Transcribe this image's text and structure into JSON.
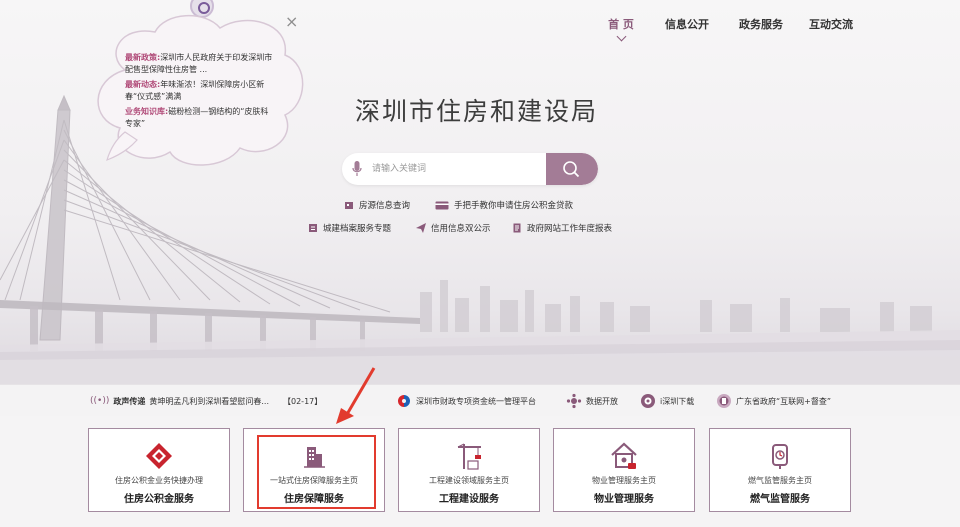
{
  "nav": {
    "items": [
      "首 页",
      "信息公开",
      "政务服务",
      "互动交流"
    ],
    "active_index": 0
  },
  "cloud": {
    "rows": [
      {
        "label": "最新政策:",
        "text": "深圳市人民政府关于印发深圳市配售型保障性住房管 ..."
      },
      {
        "label": "最新动态:",
        "text": "年味渐浓！深圳保障房小区新春“仪式感”满满"
      },
      {
        "label": "业务知识库:",
        "text": "磁粉检测—钢结构的“皮肤科专家”"
      }
    ],
    "close_label": "×"
  },
  "site_title": "深圳市住房和建设局",
  "search": {
    "placeholder": "请输入关键词",
    "button_icon": "search-icon"
  },
  "quick_links": [
    {
      "label": "房源信息查询",
      "icon": "house-info-icon"
    },
    {
      "label": "手把手教你申请住房公积金贷款",
      "icon": "card-icon"
    },
    {
      "label": "城建档案服务专题",
      "icon": "archive-icon"
    },
    {
      "label": "信用信息双公示",
      "icon": "send-icon"
    },
    {
      "label": "政府网站工作年度报表",
      "icon": "report-icon"
    }
  ],
  "infobar": {
    "notice_label": "政声传递",
    "notice_text": "黄坤明孟凡利到深圳看望慰问春...",
    "notice_date": "【02-17】",
    "links": [
      {
        "label": "深圳市财政专项资金统一管理平台",
        "icon": "finance-platform-icon"
      },
      {
        "label": "数据开放",
        "icon": "data-open-icon"
      },
      {
        "label": "i深圳下载",
        "icon": "i-shenzhen-icon"
      },
      {
        "label": "广东省政府“互联网+督查”",
        "icon": "supervision-icon"
      }
    ]
  },
  "cards": [
    {
      "sub": "住房公积金业务快捷办理",
      "main": "住房公积金服务",
      "icon": "housing-fund-icon"
    },
    {
      "sub": "一站式住房保障服务主页",
      "main": "住房保障服务",
      "icon": "building-icon"
    },
    {
      "sub": "工程建设领域服务主页",
      "main": "工程建设服务",
      "icon": "crane-icon"
    },
    {
      "sub": "物业管理服务主页",
      "main": "物业管理服务",
      "icon": "property-icon"
    },
    {
      "sub": "燃气监管服务主页",
      "main": "燃气监管服务",
      "icon": "gas-icon"
    }
  ],
  "colors": {
    "accent": "#a37c96",
    "highlight": "#e23b2e",
    "label_pink": "#b04a78"
  }
}
